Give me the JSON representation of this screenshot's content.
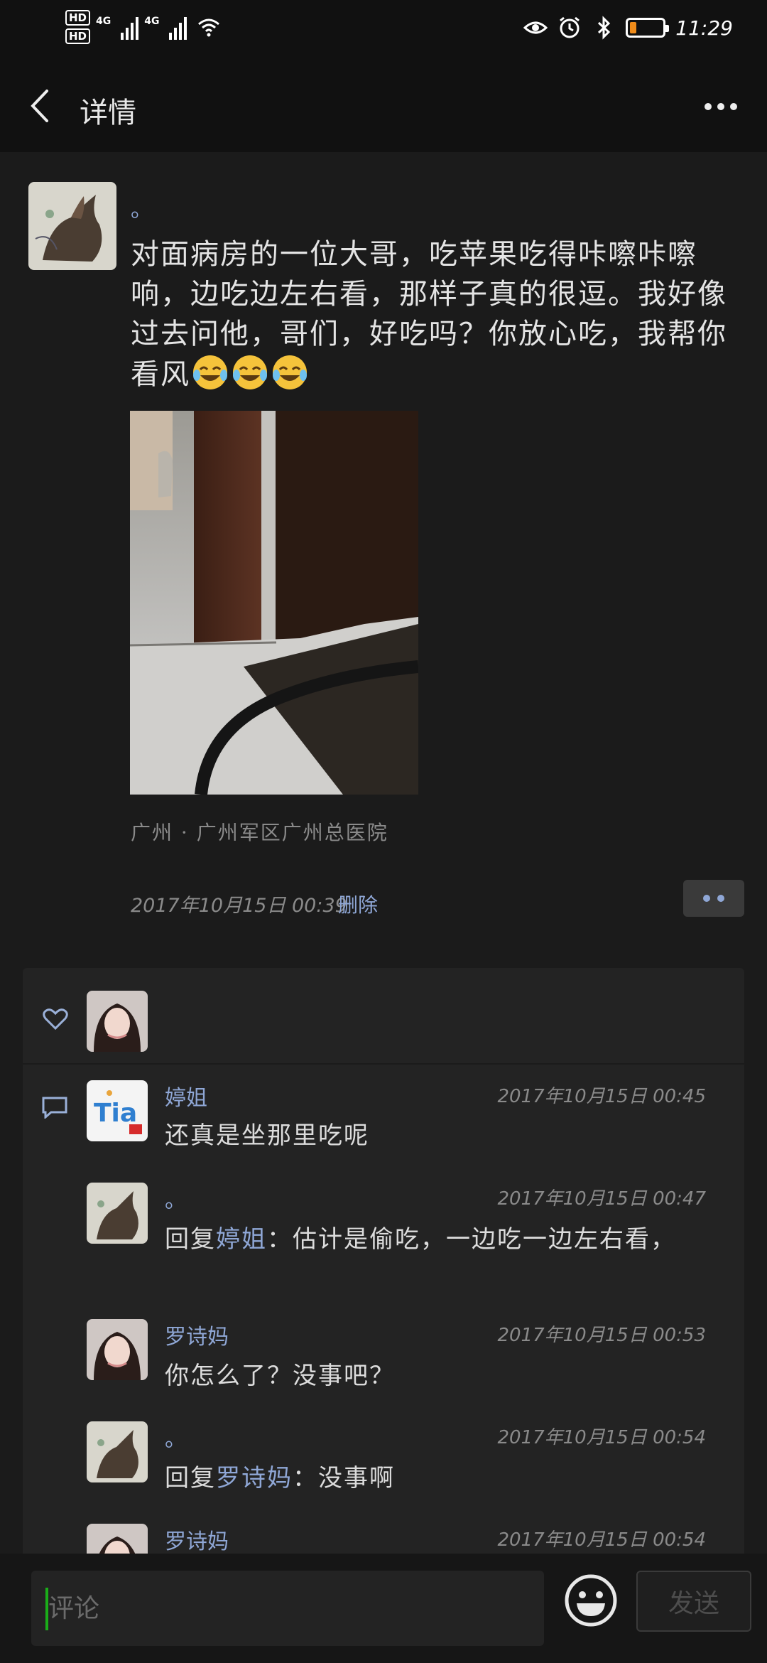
{
  "status_bar": {
    "hd1": "HD",
    "hd2": "HD",
    "network1": "4G",
    "network2": "4G",
    "time": "11:29",
    "battery_level": 0.18
  },
  "header": {
    "title": "详情"
  },
  "post": {
    "author": "。",
    "text": "对面病房的一位大哥，吃苹果吃得咔嚓咔嚓响，边吃边左右看，那样子真的很逗。我好像过去问他，哥们，好吃吗？你放心吃，我帮你看风",
    "emoji": [
      "😂",
      "😂",
      "😂"
    ],
    "location": "广州 · 广州军区广州总医院",
    "time": "2017年10月15日  00:39",
    "delete_label": "删除"
  },
  "comments": [
    {
      "name": "婷姐",
      "time": "2017年10月15日  00:45",
      "text": "还真是坐那里吃呢",
      "reply_prefix": "",
      "reply_to": "",
      "reply_sep": ""
    },
    {
      "name": "。",
      "time": "2017年10月15日  00:47",
      "text": "估计是偷吃，一边吃一边左右看，",
      "reply_prefix": "回复",
      "reply_to": "婷姐",
      "reply_sep": "："
    },
    {
      "name": "罗诗妈",
      "time": "2017年10月15日  00:53",
      "text": "你怎么了？没事吧？",
      "reply_prefix": "",
      "reply_to": "",
      "reply_sep": ""
    },
    {
      "name": "。",
      "time": "2017年10月15日  00:54",
      "text": "没事啊",
      "reply_prefix": "回复",
      "reply_to": "罗诗妈",
      "reply_sep": "："
    },
    {
      "name": "罗诗妈",
      "time": "2017年10月15日  00:54",
      "text": "",
      "reply_prefix": "",
      "reply_to": "",
      "reply_sep": ""
    }
  ],
  "bottom_bar": {
    "comment_placeholder": "评论",
    "send_label": "发送"
  },
  "icons": {
    "back": "back-arrow-icon",
    "more": "more-dots-icon",
    "like": "heart-icon",
    "comment": "comment-bubble-icon",
    "emoji": "smiley-icon"
  },
  "colors": {
    "accent_name": "#8fa7d6",
    "cursor": "#1aad19",
    "background": "#1b1b1b",
    "panel": "#232323"
  }
}
